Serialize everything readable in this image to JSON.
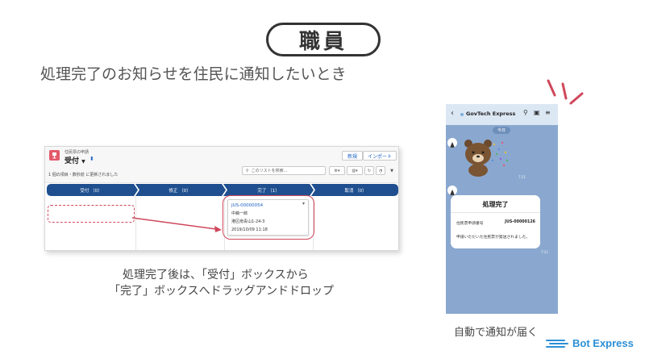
{
  "header": {
    "role": "職員",
    "headline": "処理完了のお知らせを住民に通知したいとき"
  },
  "crm": {
    "object_label": "住民票の申請",
    "view_name": "受付",
    "meta": "1 個の項目・数秒前 に更新されました",
    "buttons": {
      "new": "新規",
      "import": "インポート"
    },
    "search_placeholder": "このリストを検索...",
    "stages": [
      {
        "label": "受付 （0）"
      },
      {
        "label": "修正 （0）"
      },
      {
        "label": "完了 （1）"
      },
      {
        "label": "取消 （0）"
      }
    ],
    "card": {
      "id": "JUS-00000054",
      "name": "中嶋一郎",
      "address": "港区南青山1-24-3",
      "datetime": "2019/10/09 11:18"
    }
  },
  "caption": {
    "line1": "処理完了後は、「受付」ボックスから",
    "line2": "「完了」ボックスへドラッグアンドドロップ"
  },
  "phone": {
    "title": "GovTech Express",
    "date_badge": "今日",
    "time1": "7:21",
    "time2": "7:21",
    "card_title": "処理完了",
    "row_label": "住民票申請番号",
    "row_value": "JUS-00000126",
    "message": "申請いただいた住民票が発送されました。"
  },
  "footer": {
    "auto_caption": "自動で通知が届く",
    "brand": "Bot Express"
  },
  "colors": {
    "accent_red": "#d0485b",
    "stage_navy": "#1f4f8f",
    "brand_blue": "#2b8fd6",
    "phone_bg": "#8aa8cf"
  }
}
